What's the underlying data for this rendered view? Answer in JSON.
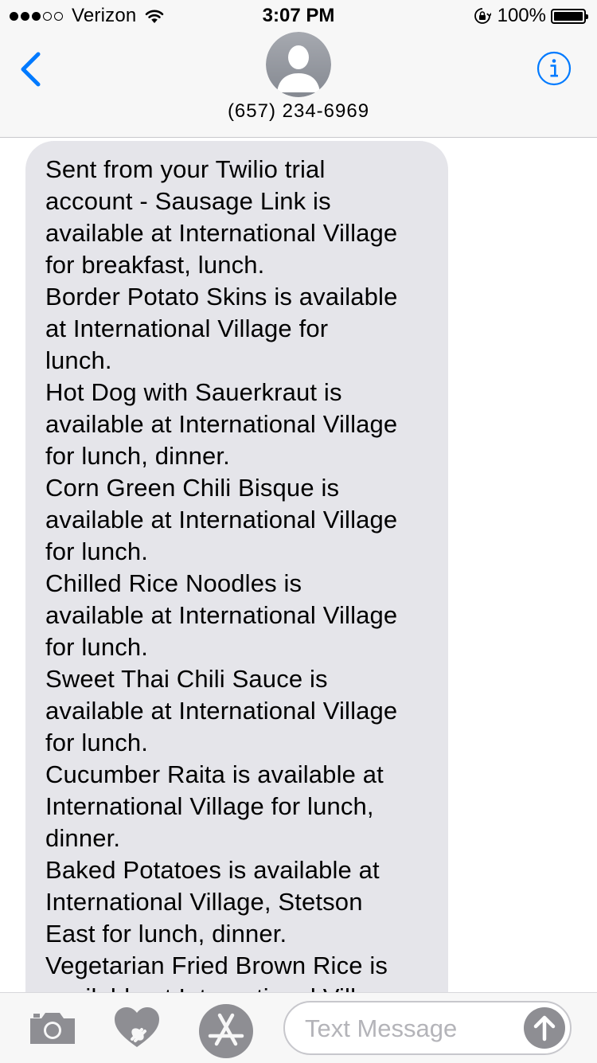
{
  "status_bar": {
    "signal_filled": 3,
    "signal_total": 5,
    "carrier": "Verizon",
    "time": "3:07 PM",
    "battery_percent": "100%",
    "battery_level": 1.0,
    "icons": [
      "signal-dots-icon",
      "wifi-icon",
      "orientation-lock-icon",
      "battery-icon"
    ]
  },
  "nav": {
    "back_icon": "chevron-left-icon",
    "avatar_icon": "person-silhouette-icon",
    "contact_name": "(657) 234-6969",
    "info_icon": "info-icon"
  },
  "conversation": {
    "lines": [
      "Sent from your Twilio trial",
      "account - Sausage Link is",
      "available at International Village",
      "for breakfast, lunch.",
      "Border Potato Skins is available",
      "at International Village for",
      "lunch.",
      "Hot Dog with Sauerkraut is",
      "available at International Village",
      "for lunch, dinner.",
      "Corn Green Chili Bisque is",
      "available at International Village",
      "for lunch.",
      "Chilled Rice Noodles is",
      "available at International Village",
      "for lunch.",
      "Sweet Thai Chili Sauce is",
      "available at International Village",
      "for lunch.",
      "Cucumber Raita is available at",
      "International Village for lunch,",
      "dinner.",
      "Baked Potatoes is available at",
      "International Village, Stetson",
      "East for lunch, dinner.",
      "Vegetarian Fried Brown Rice is",
      "available at International Village"
    ]
  },
  "input_bar": {
    "camera_icon": "camera-icon",
    "digital_touch_icon": "digital-touch-heart-icon",
    "appstore_icon": "app-store-icon",
    "placeholder": "Text Message",
    "send_icon": "arrow-up-icon"
  },
  "colors": {
    "accent": "#007aff",
    "bubble": "#e5e5ea",
    "bar_background": "#f7f7f7",
    "icon_gray": "#8e8e93",
    "placeholder": "#b4b4b9"
  }
}
